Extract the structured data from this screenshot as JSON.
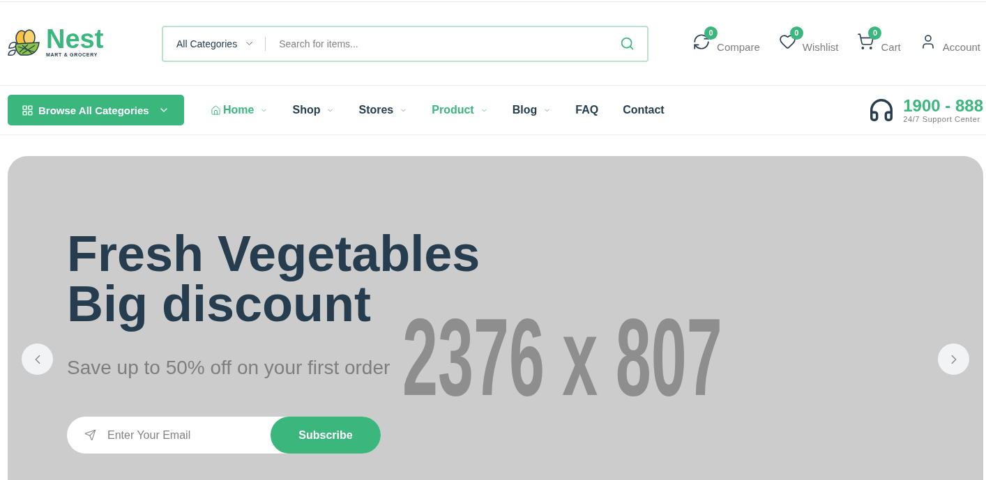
{
  "header": {
    "logo": {
      "name": "Nest",
      "tagline": "MART & GROCERY"
    },
    "search": {
      "category": "All Categories",
      "placeholder": "Search for items..."
    },
    "actions": [
      {
        "kind": "compare",
        "label": "Compare",
        "badge": "0"
      },
      {
        "kind": "wishlist",
        "label": "Wishlist",
        "badge": "0"
      },
      {
        "kind": "cart",
        "label": "Cart",
        "badge": "0"
      },
      {
        "kind": "account",
        "label": "Account"
      }
    ]
  },
  "nav": {
    "browse_button": "Browse All Categories",
    "items": [
      {
        "label": "Home",
        "selected": true,
        "has_icon": true,
        "has_dropdown": true
      },
      {
        "label": "Shop",
        "selected": false,
        "has_icon": false,
        "has_dropdown": true
      },
      {
        "label": "Stores",
        "selected": false,
        "has_icon": false,
        "has_dropdown": true
      },
      {
        "label": "Product",
        "selected": true,
        "has_icon": false,
        "has_dropdown": true
      },
      {
        "label": "Blog",
        "selected": false,
        "has_icon": false,
        "has_dropdown": true
      },
      {
        "label": "FAQ",
        "selected": false,
        "has_icon": false,
        "has_dropdown": false
      },
      {
        "label": "Contact",
        "selected": false,
        "has_icon": false,
        "has_dropdown": false
      }
    ],
    "support": {
      "phone": "1900 - 888",
      "caption": "24/7 Support Center"
    }
  },
  "hero": {
    "image_label": "2376 x 807",
    "title": "Fresh Vegetables\nBig discount",
    "subtitle": "Save up to 50% off on your first order",
    "email_placeholder": "Enter Your Email",
    "button": "Subscribe"
  }
}
